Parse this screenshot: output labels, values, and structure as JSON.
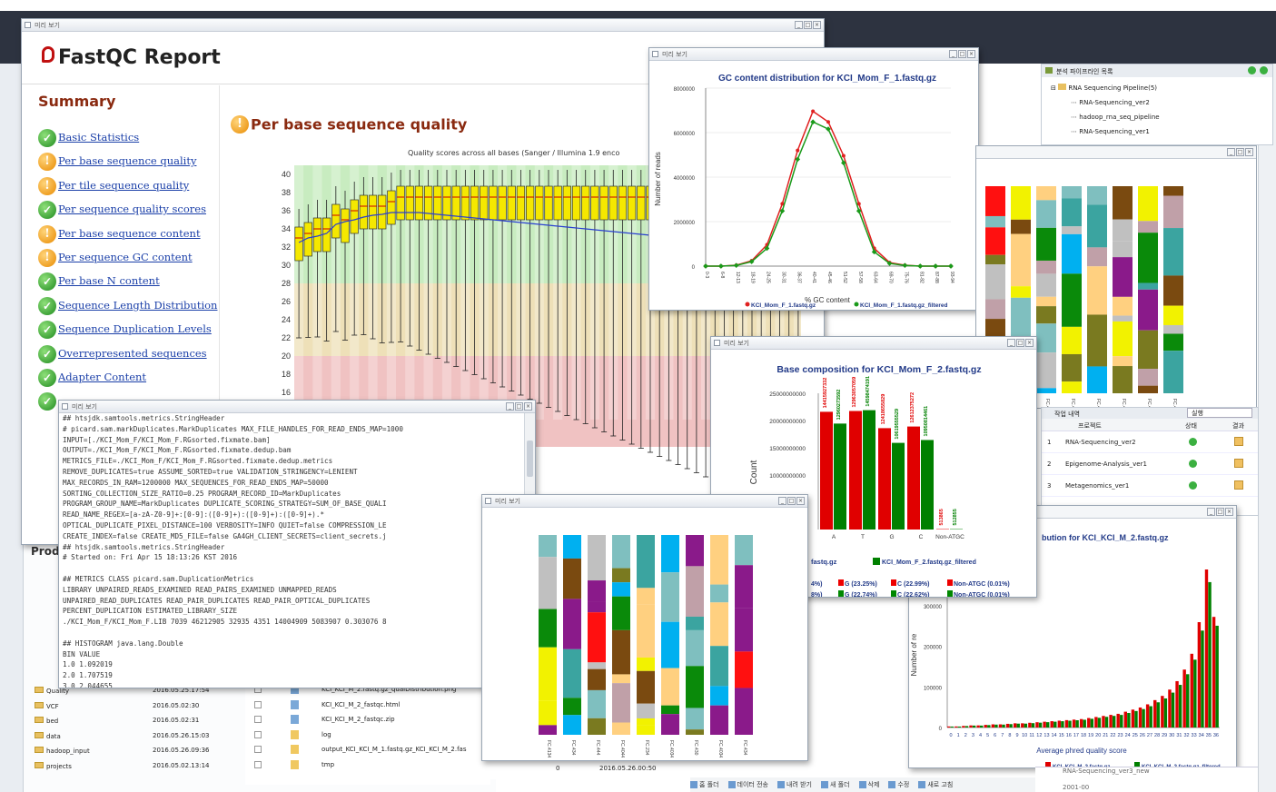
{
  "fastqc": {
    "title": "FastQC Report",
    "summary_title": "Summary",
    "module_title": "Per base sequence quality",
    "plot_title": "Quality scores across all bases (Sanger / Illumina 1.9 enco",
    "window_title": "미리 보기",
    "summary": [
      {
        "label": "Basic Statistics",
        "status": "pass"
      },
      {
        "label": "Per base sequence quality",
        "status": "warn"
      },
      {
        "label": "Per tile sequence quality",
        "status": "warn"
      },
      {
        "label": "Per sequence quality scores",
        "status": "pass"
      },
      {
        "label": "Per base sequence content",
        "status": "warn"
      },
      {
        "label": "Per sequence GC content",
        "status": "warn"
      },
      {
        "label": "Per base N content",
        "status": "pass"
      },
      {
        "label": "Sequence Length Distribution",
        "status": "pass"
      },
      {
        "label": "Sequence Duplication Levels",
        "status": "pass"
      },
      {
        "label": "Overrepresented sequences",
        "status": "pass"
      },
      {
        "label": "Adapter Content",
        "status": "pass"
      },
      {
        "label": "",
        "status": "pass"
      }
    ],
    "yticks": [
      "40",
      "38",
      "36",
      "34",
      "32",
      "30",
      "28",
      "26",
      "24",
      "22",
      "20",
      "18",
      "16",
      "14"
    ],
    "medians": [
      33,
      33.5,
      34,
      34,
      35.5,
      35,
      36,
      36.5,
      36.5,
      36.5,
      37,
      37.5,
      37.5,
      37.5,
      37.5,
      37.5,
      37.5,
      37.5,
      37.5,
      37.5,
      37.5,
      37.5,
      37.5,
      37.5,
      37.5,
      37.5,
      37.5,
      37.5,
      37.5,
      37.5,
      37.5,
      37.5,
      37.5,
      37.5,
      37.5,
      37.5,
      37.5,
      37.5,
      37.5,
      37.5,
      37.5,
      37.5,
      37.5,
      37.5,
      37.5,
      37.5,
      37.5,
      37.5,
      37.5,
      37.5,
      37.5,
      37.5,
      37.5,
      37.5,
      37.5
    ],
    "means": [
      32.5,
      33,
      33.2,
      33.5,
      34.5,
      34.8,
      35,
      35.3,
      35.5,
      35.6,
      35.8,
      35.8,
      35.8,
      35.8,
      35.7,
      35.6,
      35.5,
      35.4,
      35.3,
      35.2,
      35.1,
      35,
      34.9,
      34.8,
      34.7,
      34.6,
      34.5,
      34.4,
      34.3,
      34.2,
      34.1,
      34,
      33.9,
      33.8,
      33.7,
      33.6,
      33.5,
      33.4,
      33.3,
      33.2,
      33.1,
      33,
      32.9,
      32.8,
      32.7,
      32.6,
      32.5,
      32.4,
      32.3,
      32.2,
      32.1,
      32,
      31.9,
      31.8,
      31.7
    ]
  },
  "left_panel": {
    "products_label": "Produ",
    "tree": [
      {
        "name": "Quality",
        "date": "2016.05.25.17:54",
        "trunc": "2016.05.26..."
      },
      {
        "name": "VCF",
        "date": "2016.05.02:30",
        "trunc": "2016.05.0..."
      },
      {
        "name": "bed",
        "date": "2016.05.02:31",
        "trunc": "2016.05.02..."
      },
      {
        "name": "data",
        "date": "2016.05.26.15:03",
        "trunc": "2016.05.26.1..."
      },
      {
        "name": "hadoop_input",
        "date": "2016.05.26.09:36",
        "trunc": "201..."
      },
      {
        "name": "projects",
        "date": "2016.05.02.13:14",
        "trunc": ""
      }
    ]
  },
  "terminal": {
    "lines": [
      "## htsjdk.samtools.metrics.StringHeader",
      "# picard.sam.markDuplicates.MarkDuplicates MAX_FILE_HANDLES_FOR_READ_ENDS_MAP=1000",
      "INPUT=[./KCI_Mom_F/KCI_Mom_F.RGsorted.fixmate.bam]",
      "OUTPUT=./KCI_Mom_F/KCI_Mom_F.RGsorted.fixmate.dedup.bam",
      "METRICS_FILE=./KCI_Mom_F/KCI_Mom_F.RGsorted.fixmate.dedup.metrics",
      "REMOVE_DUPLICATES=true ASSUME_SORTED=true VALIDATION_STRINGENCY=LENIENT",
      "MAX_RECORDS_IN_RAM=1200000 MAX_SEQUENCES_FOR_READ_ENDS_MAP=50000",
      "SORTING_COLLECTION_SIZE_RATIO=0.25 PROGRAM_RECORD_ID=MarkDuplicates",
      "PROGRAM_GROUP_NAME=MarkDuplicates DUPLICATE_SCORING_STRATEGY=SUM_OF_BASE_QUALI",
      "READ_NAME_REGEX=[a-zA-Z0-9]+:[0-9]:([0-9]+):([0-9]+):([0-9]+).*",
      "OPTICAL_DUPLICATE_PIXEL_DISTANCE=100 VERBOSITY=INFO QUIET=false COMPRESSION_LE",
      "CREATE_INDEX=false CREATE_MD5_FILE=false GA4GH_CLIENT_SECRETS=client_secrets.j",
      "## htsjdk.samtools.metrics.StringHeader",
      "# Started on: Fri Apr 15 18:13:26 KST 2016",
      "",
      "## METRICS CLASS picard.sam.DuplicationMetrics",
      "LIBRARY UNPAIRED_READS_EXAMINED READ_PAIRS_EXAMINED UNMAPPED_READS",
      "UNPAIRED_READ_DUPLICATES READ_PAIR_DUPLICATES READ_PAIR_OPTICAL_DUPLICATES",
      "PERCENT_DUPLICATION ESTIMATED_LIBRARY_SIZE",
      "./KCI_Mom_F/KCI_Mom_F.LIB 7039 46212905 32935 4351 14004909 5083907 0.303076 8",
      "",
      "## HISTOGRAM java.lang.Double",
      "BIN VALUE",
      "1.0 1.092019",
      "2.0 1.707519",
      "3.0 2.044655"
    ]
  },
  "gc_chart": {
    "title": "GC content distribution for KCI_Mom_F_1.fastq.gz",
    "xlabel": "% GC content",
    "ylabel": "Number of reads",
    "yticks": [
      "8000000",
      "6000000",
      "4000000",
      "2000000",
      "0"
    ],
    "x": [
      "0-3",
      "6-8",
      "12-13",
      "18-19",
      "24-25",
      "30-31",
      "36-37",
      "40-41",
      "45-46",
      "51-52",
      "57-58",
      "63-64",
      "69-70",
      "75-76",
      "81-82",
      "87-88",
      "93-94"
    ],
    "series": [
      {
        "name": "KCI_Mom_F_1.fastq.gz",
        "color": "#e02020",
        "values": [
          0,
          0,
          0.05,
          0.3,
          1.2,
          3.5,
          6.5,
          8.7,
          8.1,
          6.2,
          3.5,
          1.0,
          0.2,
          0.05,
          0,
          0,
          0
        ]
      },
      {
        "name": "KCI_Mom_F_1.fastq.gz_filtered",
        "color": "#1a9a1a",
        "values": [
          0,
          0,
          0.04,
          0.25,
          1.0,
          3.1,
          6.0,
          8.1,
          7.7,
          5.8,
          3.1,
          0.8,
          0.15,
          0.04,
          0,
          0,
          0
        ]
      }
    ]
  },
  "base_comp": {
    "title": "Base composition for KCI_Mom_F_2.fastq.gz",
    "ylabel": "Count",
    "yticks": [
      "25000000000",
      "20000000000",
      "15000000000",
      "10000000000"
    ],
    "categories": [
      "A",
      "T",
      "G",
      "C",
      "Non-ATGC"
    ],
    "series": [
      {
        "name": "KCI_Mom_F_2.fastq.gz",
        "color": "#e00000",
        "labels": [
          "14415927332",
          "12963057059",
          "12418655829",
          "12612375272",
          "513865"
        ],
        "values": [
          14.4,
          14.5,
          12.4,
          12.6,
          0.05
        ]
      },
      {
        "name": "KCI_Mom_F_2.fastq.gz_filtered",
        "color": "#008000",
        "labels": [
          "12960273592",
          "14598474191",
          "10619555529",
          "10950814461",
          "512855"
        ],
        "values": [
          12.96,
          14.6,
          10.6,
          10.95,
          0.05
        ]
      }
    ],
    "legend_left": "fastq.gz",
    "legend_right": "KCI_Mom_F_2.fastq.gz_filtered",
    "pct_row1": [
      "4%)",
      "G (23.25%)",
      "C (22.99%)",
      "Non-ATGC (0.01%)"
    ],
    "pct_row2": [
      "8%)",
      "G (22.74%)",
      "C (22.62%)",
      "Non-ATGC (0.01%)"
    ]
  },
  "pipeline": {
    "title": "분석 파이프라인 목록",
    "root": "RNA Sequencing Pipeline(5)",
    "items": [
      "RNA-Sequencing_ver2",
      "hadoop_rna_seq_pipeline",
      "RNA-Sequencing_ver1"
    ]
  },
  "history": {
    "title": "작업 내역",
    "filter": "실행",
    "columns": [
      "프로젝트",
      "상태",
      "결과"
    ],
    "rows": [
      {
        "n": "1",
        "name": "RNA-Sequencing_ver2"
      },
      {
        "n": "2",
        "name": "Epigenome-Analysis_ver1"
      },
      {
        "n": "3",
        "name": "Metagenomics_ver1"
      }
    ],
    "bottom_row": "RNA-Sequencing_ver3_new",
    "bottom_row2": "2001-00"
  },
  "qual_hist": {
    "title": "bution for KCI_KCI_M_2.fastq.gz",
    "xlabel": "Average phred quality score",
    "ylabel": "Number of re",
    "yticks": [
      "300000",
      "200000",
      "100000",
      "0"
    ],
    "legend": [
      "KCI_KCI_M_2.fastq.gz",
      "KCI_KCI_M_2.fastq.gz_filtered"
    ],
    "values": [
      1,
      1,
      1.5,
      2,
      2,
      2.5,
      3,
      3,
      3.5,
      4,
      4,
      4.5,
      5,
      5.5,
      6,
      6.5,
      7,
      7.5,
      8,
      9,
      10,
      11,
      12,
      13,
      15,
      17,
      19,
      22,
      26,
      30,
      36,
      44,
      55,
      70,
      100,
      150,
      105
    ],
    "xticks": [
      "0",
      "1",
      "2",
      "3",
      "4",
      "5",
      "6",
      "7",
      "8",
      "9",
      "10",
      "11",
      "12",
      "13",
      "14",
      "15",
      "16",
      "17",
      "18",
      "19",
      "20",
      "21",
      "22",
      "23",
      "24",
      "25",
      "26",
      "27",
      "28",
      "29",
      "30",
      "31",
      "32",
      "33",
      "34",
      "35",
      "36"
    ]
  },
  "files": {
    "rows": [
      {
        "name": "KCI_KCI_M_2.fastq.gz_qualDistribution.png"
      },
      {
        "name": "KCI_KCI_M_2_fastqc.html"
      },
      {
        "name": "KCI_KCI_M_2_fastqc.zip"
      },
      {
        "name": "log"
      },
      {
        "name": "output_KCI_KCI_M_1.fastq.gz_KCI_KCI_M_2.fas"
      },
      {
        "name": "tmp",
        "size": "0",
        "date": "2016.05.26.00:50"
      }
    ]
  },
  "bottom_toolbar": [
    "홈 폴더",
    "데이터 전송",
    "내려 받기",
    "새 폴더",
    "삭제",
    "수정",
    "새로 고침"
  ],
  "stacked_right": {
    "labels": [
      "FC.414",
      "FC.464",
      "FC.434",
      "FC.455",
      "FC.445",
      "FC.433",
      "FC.434",
      "FC.423"
    ]
  },
  "stacked_mid": {
    "labels": [
      "FC.4134",
      "FC.434",
      "FC.444",
      "FC.4044",
      "FC.234",
      "FC.4034",
      "FC.430",
      "FC.4034",
      "FC.434"
    ]
  }
}
